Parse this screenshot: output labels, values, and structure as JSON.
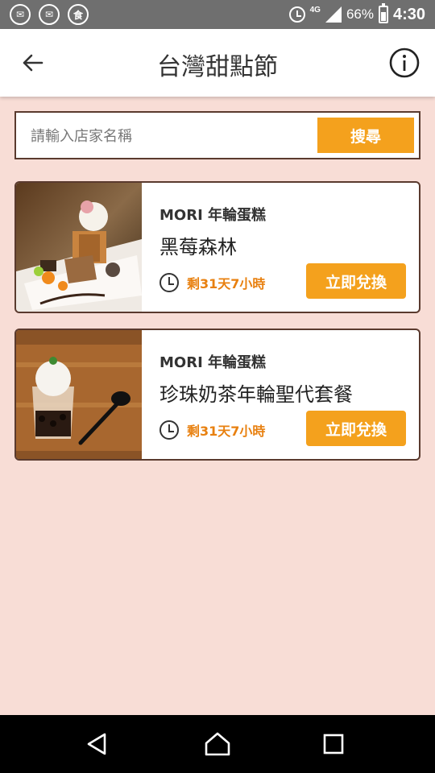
{
  "status_bar": {
    "notification_icons": [
      "mail-icon",
      "mail-icon",
      "food-icon"
    ],
    "notification_glyphs": [
      "✉",
      "✉",
      "食"
    ],
    "network": "4G",
    "battery": "66%",
    "time": "4:30"
  },
  "header": {
    "title": "台灣甜點節"
  },
  "search": {
    "placeholder": "請輸入店家名稱",
    "button_label": "搜尋"
  },
  "colors": {
    "accent": "#f4a11d",
    "background": "#f8ddd6",
    "border": "#5a3a2e",
    "remaining_text": "#e8800f"
  },
  "items": [
    {
      "shop": "MORI 年輪蛋糕",
      "name": "黑莓森林",
      "remaining": "剩31天7小時",
      "button_label": "立即兌換"
    },
    {
      "shop": "MORI 年輪蛋糕",
      "name": "珍珠奶茶年輪聖代套餐",
      "remaining": "剩31天7小時",
      "button_label": "立即兌換"
    }
  ]
}
